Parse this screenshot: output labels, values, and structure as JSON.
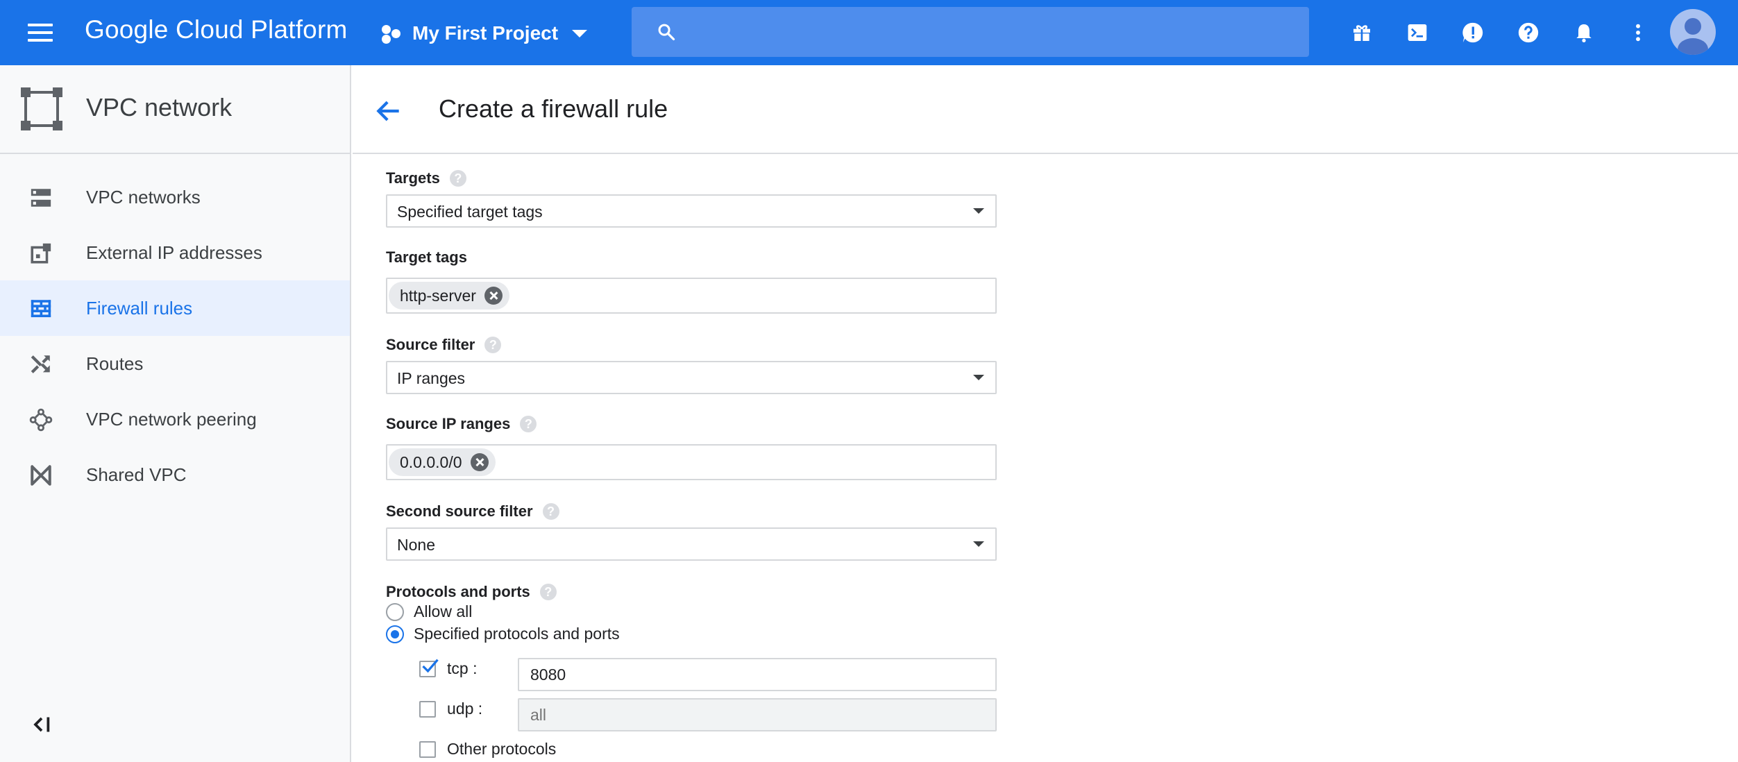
{
  "topbar": {
    "brand": "Google Cloud Platform",
    "project": "My First Project",
    "search_placeholder": "",
    "icons": [
      "gift-icon",
      "cloud-shell-icon",
      "feedback-icon",
      "help-icon",
      "notifications-icon",
      "more-vert-icon"
    ],
    "accent": "#1a73e8"
  },
  "sidebar": {
    "title": "VPC network",
    "items": [
      {
        "label": "VPC networks",
        "icon": "vpc-networks-icon"
      },
      {
        "label": "External IP addresses",
        "icon": "external-ip-icon"
      },
      {
        "label": "Firewall rules",
        "icon": "firewall-icon",
        "active": true
      },
      {
        "label": "Routes",
        "icon": "routes-icon"
      },
      {
        "label": "VPC network peering",
        "icon": "peering-icon"
      },
      {
        "label": "Shared VPC",
        "icon": "shared-vpc-icon"
      }
    ]
  },
  "main": {
    "title": "Create a firewall rule",
    "targets": {
      "label": "Targets",
      "value": "Specified target tags"
    },
    "target_tags": {
      "label": "Target tags",
      "chips": [
        "http-server"
      ]
    },
    "source_filter": {
      "label": "Source filter",
      "value": "IP ranges"
    },
    "source_ip_ranges": {
      "label": "Source IP ranges",
      "chips": [
        "0.0.0.0/0"
      ]
    },
    "second_source_filter": {
      "label": "Second source filter",
      "value": "None"
    },
    "protocols": {
      "label": "Protocols and ports",
      "allow_all": "Allow all",
      "specified": "Specified protocols and ports",
      "selected": "specified",
      "tcp": {
        "label": "tcp :",
        "checked": true,
        "value": "8080"
      },
      "udp": {
        "label": "udp :",
        "checked": false,
        "placeholder": "all"
      },
      "other": {
        "label": "Other protocols",
        "checked": false
      }
    }
  }
}
